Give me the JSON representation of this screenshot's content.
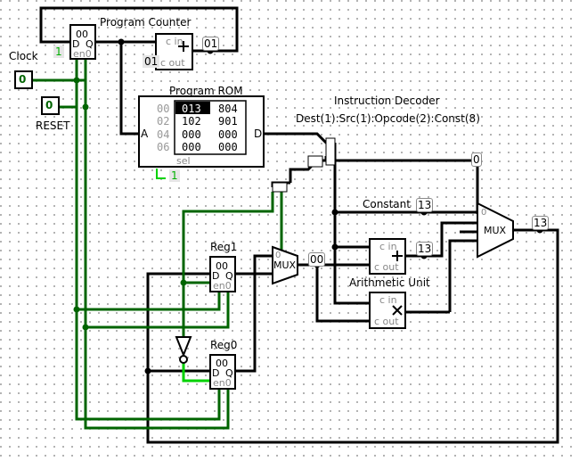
{
  "labels": {
    "program_counter": "Program Counter",
    "program_rom": "Program ROM",
    "instruction_decoder": "Instruction Decoder",
    "instruction_format": "Dest(1):Src(1):Opcode(2):Const(8)",
    "clock": "Clock",
    "reset": "RESET",
    "reg1": "Reg1",
    "reg0": "Reg0",
    "constant": "Constant",
    "arithmetic_unit": "Arithmetic Unit"
  },
  "inputs": {
    "clock_value": "0",
    "reset_value": "0"
  },
  "program_counter": {
    "register_value": "00",
    "enable_const": "1",
    "adder_const": "01",
    "adder_output_probe": "01"
  },
  "rom": {
    "addresses": [
      "00",
      "02",
      "04",
      "06"
    ],
    "rows": [
      [
        "013",
        "804"
      ],
      [
        "102",
        "901"
      ],
      [
        "000",
        "000"
      ],
      [
        "000",
        "000"
      ]
    ],
    "highlighted": "013",
    "sel_const": "1",
    "pin_a": "A",
    "pin_d": "D",
    "pin_sel": "sel"
  },
  "registers": {
    "reg1_value": "00",
    "reg0_value": "00"
  },
  "pins": {
    "d": "D",
    "q": "Q",
    "en": "en",
    "zero": "0",
    "c_in": "c in",
    "c_out": "c out",
    "mux": "MUX",
    "mux_sel0": "0"
  },
  "probes": {
    "decoder_top": "0",
    "constant": "13",
    "adder_out": "13",
    "mux_out": "13",
    "src_mux_out": "00"
  },
  "colors": {
    "wire_black": "#000000",
    "wire_green_dark": "#006400",
    "wire_green_bright": "#00d200",
    "dot_grid": "#9a9a9a"
  }
}
